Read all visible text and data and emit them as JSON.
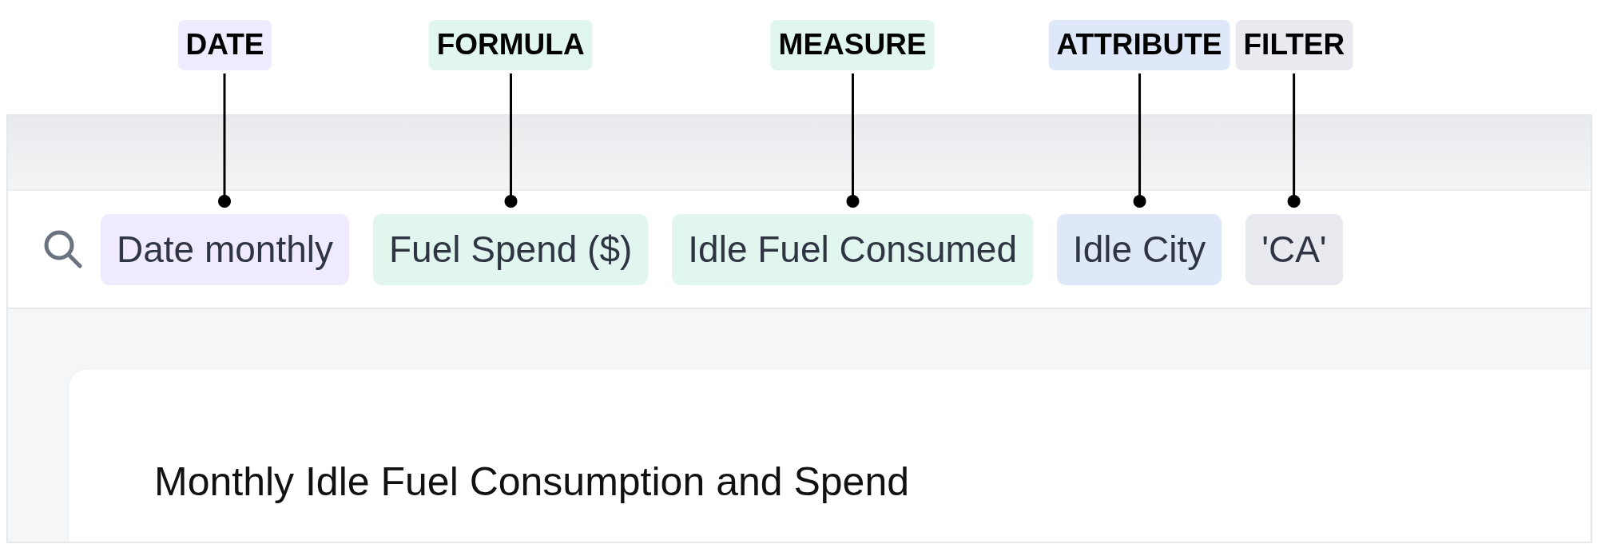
{
  "search_bar": {
    "tokens": [
      {
        "kind": "date",
        "text": "Date monthly",
        "callout": "DATE"
      },
      {
        "kind": "formula",
        "text": "Fuel Spend ($)",
        "callout": "FORMULA"
      },
      {
        "kind": "measure",
        "text": "Idle Fuel Consumed",
        "callout": "MEASURE"
      },
      {
        "kind": "attribute",
        "text": "Idle City",
        "callout": "ATTRIBUTE"
      },
      {
        "kind": "filter",
        "text": "'CA'",
        "callout": "FILTER"
      }
    ]
  },
  "card": {
    "title": "Monthly Idle Fuel Consumption and Spend"
  }
}
